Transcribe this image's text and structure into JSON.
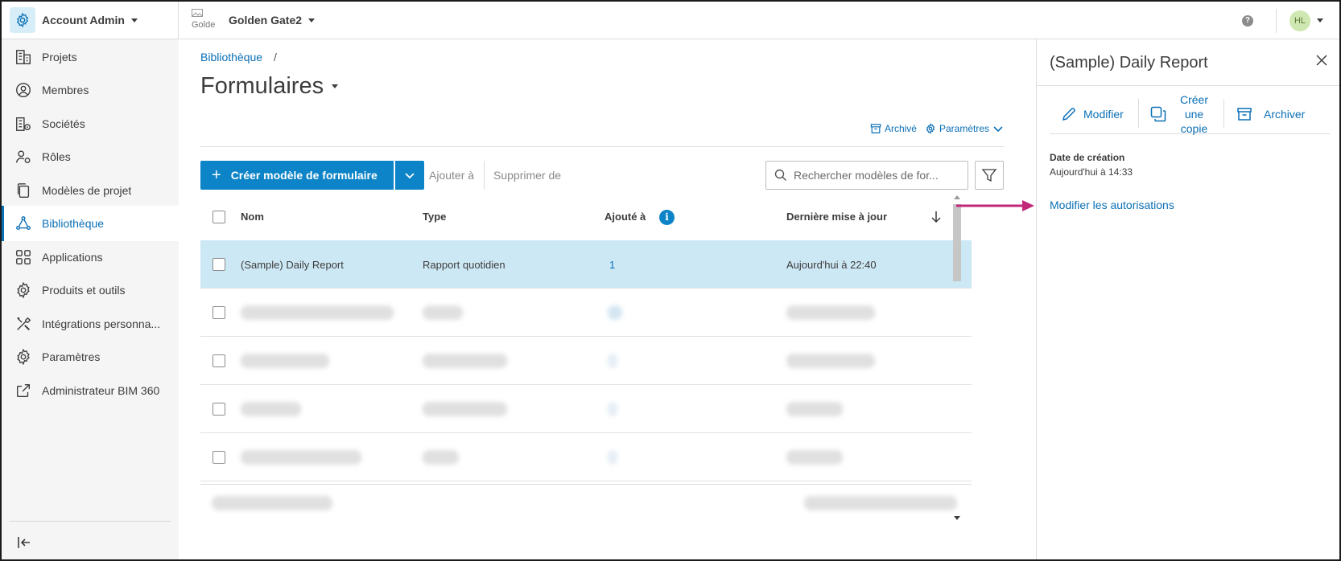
{
  "topbar": {
    "account": "Account Admin",
    "project_img_alt": "Golde",
    "project": "Golden Gate2",
    "help": "?",
    "avatar": "HL"
  },
  "sidebar": {
    "items": [
      {
        "label": "Projets",
        "icon": "building-icon"
      },
      {
        "label": "Membres",
        "icon": "user-circle-icon"
      },
      {
        "label": "Sociétés",
        "icon": "company-icon"
      },
      {
        "label": "Rôles",
        "icon": "role-icon"
      },
      {
        "label": "Modèles de projet",
        "icon": "copy-icon"
      },
      {
        "label": "Bibliothèque",
        "icon": "library-icon",
        "active": true
      },
      {
        "label": "Applications",
        "icon": "grid-icon"
      },
      {
        "label": "Produits et outils",
        "icon": "gear-products-icon"
      },
      {
        "label": "Intégrations personna...",
        "icon": "tools-icon"
      },
      {
        "label": "Paramètres",
        "icon": "gear-icon"
      },
      {
        "label": "Administrateur BIM 360",
        "icon": "external-link-icon"
      }
    ]
  },
  "main": {
    "breadcrumb": "Bibliothèque",
    "breadcrumb_sep": "/",
    "title": "Formulaires",
    "archived_link": "Archivé",
    "settings_link": "Paramètres",
    "create_button": "Créer modèle de formulaire",
    "add_to": "Ajouter à",
    "remove_from": "Supprimer de",
    "search_placeholder": "Rechercher modèles de for...",
    "table": {
      "headers": {
        "name": "Nom",
        "type": "Type",
        "added_to": "Ajouté à",
        "last_update": "Dernière mise à jour"
      },
      "info_icon": "i",
      "rows": [
        {
          "name": "(Sample) Daily Report",
          "type": "Rapport quotidien",
          "added_to": "1",
          "updated": "Aujourd'hui à 22:40"
        }
      ]
    }
  },
  "panel": {
    "title": "(Sample) Daily Report",
    "edit": "Modifier",
    "copy_1": "Créer",
    "copy_2": "une",
    "copy_3": "copie",
    "archive": "Archiver",
    "created_label": "Date de création",
    "created_value": "Aujourd'hui à 14:33",
    "permissions_link": "Modifier les autorisations"
  },
  "colors": {
    "accent": "#0c84c7",
    "link": "#0a6fb5",
    "selected_row": "#cde8f5",
    "annotation_arrow": "#c2287a"
  }
}
